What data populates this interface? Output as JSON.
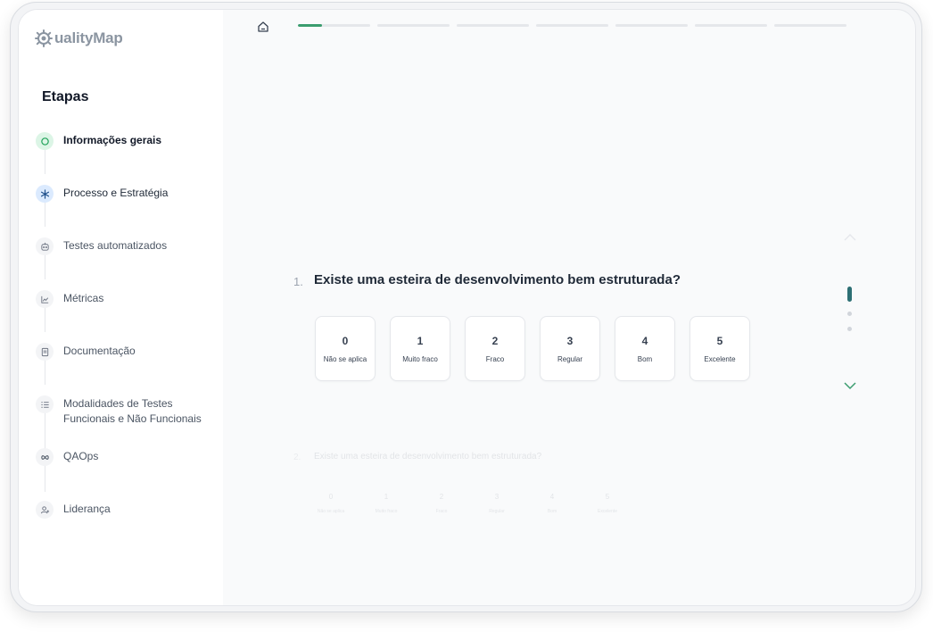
{
  "app": {
    "logo_text": "ualityMap"
  },
  "sidebar": {
    "title": "Etapas",
    "steps": [
      {
        "label": "Informações gerais",
        "icon": "check-circle-icon",
        "state": "done"
      },
      {
        "label": "Processo e Estratégia",
        "icon": "asterisk-icon",
        "state": "current"
      },
      {
        "label": "Testes automatizados",
        "icon": "robot-icon",
        "state": "pending"
      },
      {
        "label": "Métricas",
        "icon": "line-chart-icon",
        "state": "pending"
      },
      {
        "label": "Documentação",
        "icon": "document-icon",
        "state": "pending"
      },
      {
        "label": "Modalidades de Testes Funcionais e Não Funcionais",
        "icon": "list-icon",
        "state": "pending"
      },
      {
        "label": "QAOps",
        "icon": "infinity-icon",
        "state": "pending"
      },
      {
        "label": "Liderança",
        "icon": "users-icon",
        "state": "pending"
      }
    ]
  },
  "progress": {
    "segments": 7,
    "current_fraction": 0.33
  },
  "question": {
    "number": "1.",
    "text": "Existe uma esteira de desenvolvimento bem estruturada?",
    "options": [
      {
        "value": "0",
        "label": "Não se aplica"
      },
      {
        "value": "1",
        "label": "Muito fraco"
      },
      {
        "value": "2",
        "label": "Fraco"
      },
      {
        "value": "3",
        "label": "Regular"
      },
      {
        "value": "4",
        "label": "Bom"
      },
      {
        "value": "5",
        "label": "Excelente"
      }
    ]
  },
  "next_question": {
    "number": "2.",
    "text": "Existe uma esteira de desenvolvimento bem estruturada?",
    "options": [
      {
        "value": "0",
        "label": "Não se aplica"
      },
      {
        "value": "1",
        "label": "Muito fraco"
      },
      {
        "value": "2",
        "label": "Fraco"
      },
      {
        "value": "3",
        "label": "Regular"
      },
      {
        "value": "4",
        "label": "Bom"
      },
      {
        "value": "5",
        "label": "Excelente"
      }
    ]
  },
  "colors": {
    "accent_green": "#3b9d6f",
    "nav_teal": "#2d6f74",
    "done_icon_bg": "#dcf5e6",
    "current_icon_bg": "#dbeafe"
  },
  "icons": {
    "home": "home-icon",
    "up": "chevron-up-icon",
    "down": "chevron-down-icon",
    "logo": "gear-logo-icon"
  }
}
